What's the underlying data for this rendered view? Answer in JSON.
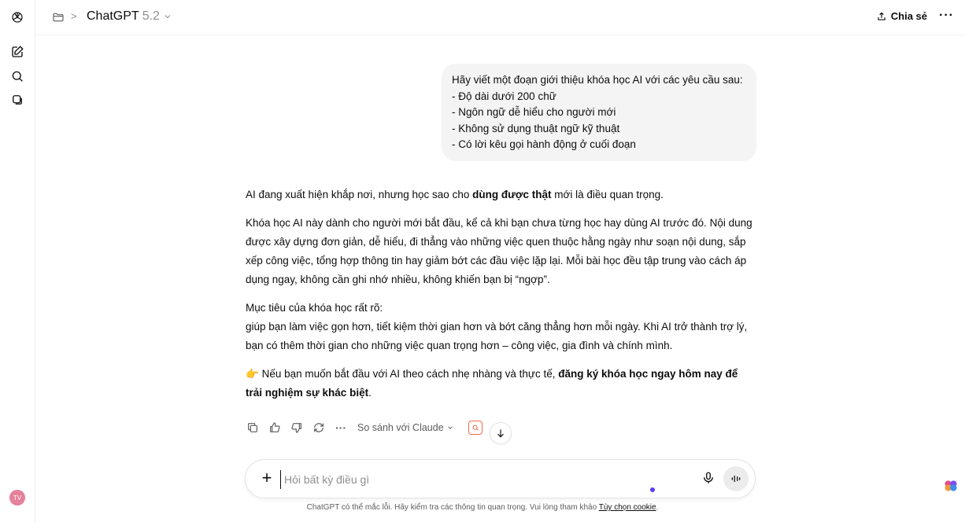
{
  "header": {
    "model_name": "ChatGPT",
    "model_version": "5.2",
    "share_label": "Chia sẻ",
    "more_label": "···",
    "breadcrumb_sep": ">"
  },
  "sidebar": {
    "avatar_initials": "TV",
    "icons": [
      "chatgpt-logo-icon",
      "new-chat-icon",
      "search-icon",
      "library-icon"
    ]
  },
  "user_message": {
    "lines": [
      "Hãy viết một đoạn giới thiệu khóa học AI với các yêu cầu sau:",
      "- Độ dài dưới 200 chữ",
      "- Ngôn ngữ dễ hiểu cho người mới",
      "- Không sử dụng thuật ngữ kỹ thuật",
      "- Có lời kêu gọi hành động ở cuối đoạn"
    ]
  },
  "assistant_message": {
    "p1_pre": "AI đang xuất hiện khắp nơi, nhưng học sao cho ",
    "p1_bold": "dùng được thật",
    "p1_post": " mới là điều quan trọng.",
    "p2": "Khóa học AI này dành cho người mới bắt đầu, kể cả khi bạn chưa từng học hay dùng AI trước đó. Nội dung được xây dựng đơn giản, dễ hiểu, đi thẳng vào những việc quen thuộc hằng ngày như soạn nội dung, sắp xếp công việc, tổng hợp thông tin hay giảm bớt các đầu việc lặp lại. Mỗi bài học đều tập trung vào cách áp dụng ngay, không cần ghi nhớ nhiều, không khiến bạn bị “ngợp”.",
    "p3_line1": "Mục tiêu của khóa học rất rõ:",
    "p3_line2": "giúp bạn làm việc gọn hơn, tiết kiệm thời gian hơn và bớt căng thẳng hơn mỗi ngày. Khi AI trở thành trợ lý, bạn có thêm thời gian cho những việc quan trọng hơn – công việc, gia đình và chính mình.",
    "p4_emoji": "👉",
    "p4_pre": " Nếu bạn muốn bắt đầu với AI theo cách nhẹ nhàng và thực tế, ",
    "p4_bold": "đăng ký khóa học ngay hôm nay để trải nghiệm sự khác biệt",
    "p4_post": "."
  },
  "actions": {
    "more": "···",
    "compare_label": "So sánh với Claude"
  },
  "composer": {
    "placeholder": "Hỏi bất kỳ điều gì"
  },
  "footer": {
    "text": "ChatGPT có thể mắc lỗi. Hãy kiểm tra các thông tin quan trọng. Vui lòng tham khảo ",
    "link": "Tùy chọn cookie",
    "end": "."
  },
  "colors": {
    "bubble_bg": "#f4f4f4",
    "accent_dot": "#5b3df5",
    "claude_badge": "#f06a4a",
    "avatar_bg": "#e5819a"
  }
}
